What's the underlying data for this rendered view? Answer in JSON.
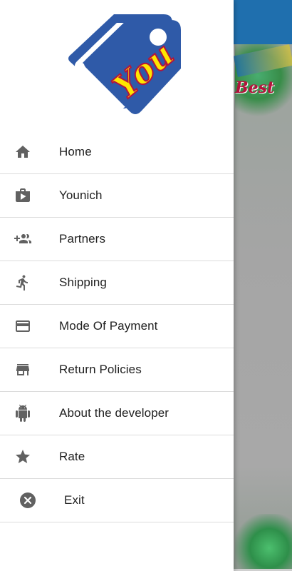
{
  "background": {
    "banner_word": "Best"
  },
  "drawer": {
    "logo_text": "You",
    "colors": {
      "logo_blue": "#2f5aa8",
      "logo_text": "#ffe600",
      "logo_outline": "#b3143c"
    },
    "items": [
      {
        "label": "Home",
        "icon": "home-icon"
      },
      {
        "label": "Younich",
        "icon": "shop-bag-icon"
      },
      {
        "label": "Partners",
        "icon": "group-add-icon"
      },
      {
        "label": "Shipping",
        "icon": "walking-person-icon"
      },
      {
        "label": "Mode Of Payment",
        "icon": "credit-card-icon"
      },
      {
        "label": "Return Policies",
        "icon": "storefront-icon"
      },
      {
        "label": "About the developer",
        "icon": "android-icon"
      },
      {
        "label": "Rate",
        "icon": "star-icon"
      },
      {
        "label": "Exit",
        "icon": "close-circle-icon"
      }
    ]
  }
}
